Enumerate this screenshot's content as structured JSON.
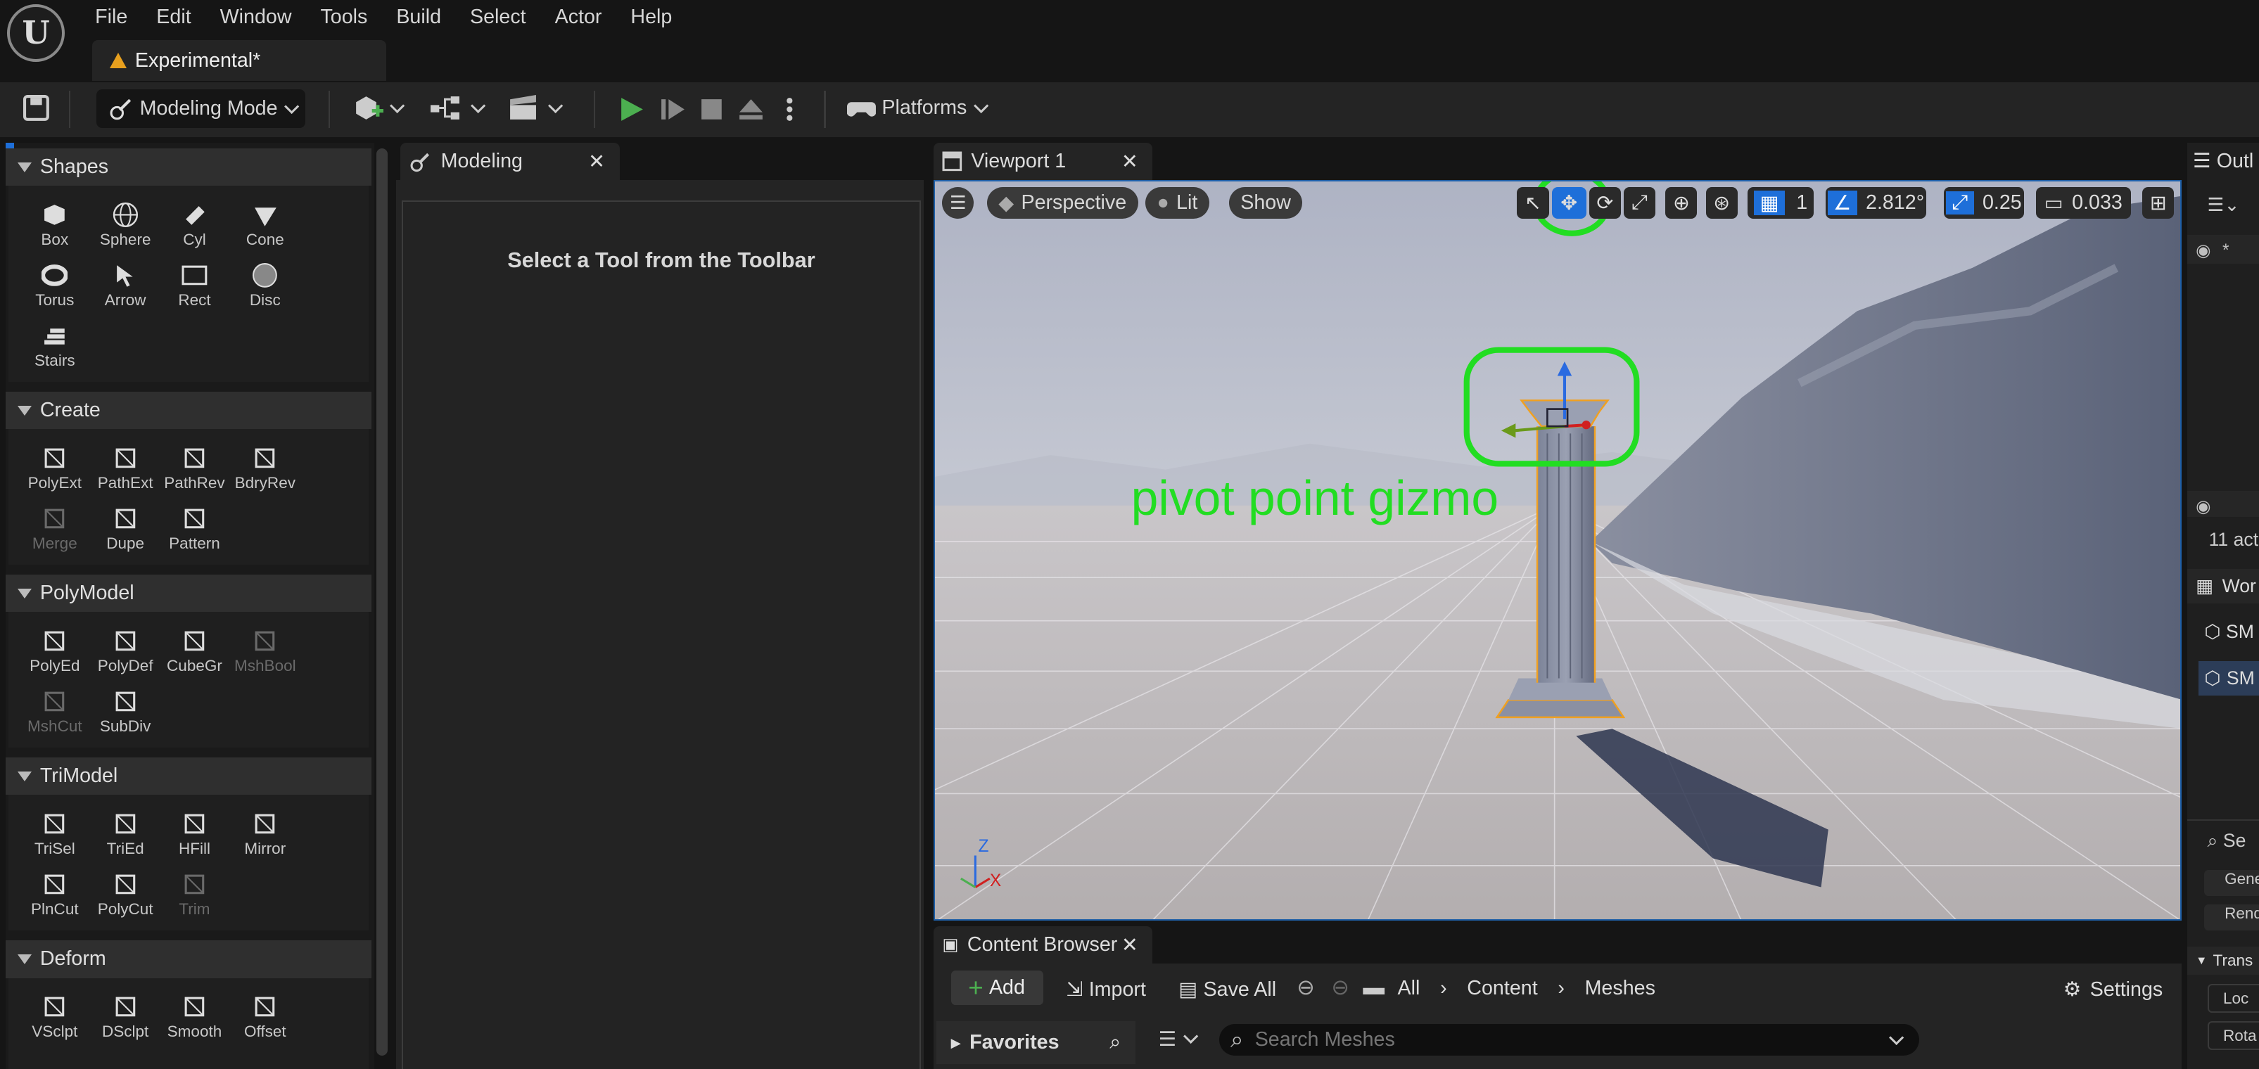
{
  "menu": [
    "File",
    "Edit",
    "Window",
    "Tools",
    "Build",
    "Select",
    "Actor",
    "Help"
  ],
  "doc_tab": "Experimental*",
  "toolbar": {
    "mode": "Modeling Mode",
    "platforms": "Platforms"
  },
  "sections": [
    {
      "title": "Shapes",
      "tools": [
        {
          "label": "Box",
          "icon": "box-icon"
        },
        {
          "label": "Sphere",
          "icon": "sphere-icon"
        },
        {
          "label": "Cyl",
          "icon": "cylinder-icon"
        },
        {
          "label": "Cone",
          "icon": "cone-icon"
        },
        {
          "label": "Torus",
          "icon": "torus-icon"
        },
        {
          "label": "Arrow",
          "icon": "arrow-icon"
        },
        {
          "label": "Rect",
          "icon": "rect-icon"
        },
        {
          "label": "Disc",
          "icon": "disc-icon"
        },
        {
          "label": "Stairs",
          "icon": "stairs-icon"
        }
      ]
    },
    {
      "title": "Create",
      "tools": [
        {
          "label": "PolyExt",
          "icon": "polyext-icon"
        },
        {
          "label": "PathExt",
          "icon": "pathext-icon"
        },
        {
          "label": "PathRev",
          "icon": "pathrev-icon"
        },
        {
          "label": "BdryRev",
          "icon": "bdryrev-icon"
        },
        {
          "label": "Merge",
          "icon": "merge-icon",
          "disabled": true
        },
        {
          "label": "Dupe",
          "icon": "dupe-icon"
        },
        {
          "label": "Pattern",
          "icon": "pattern-icon"
        }
      ]
    },
    {
      "title": "PolyModel",
      "tools": [
        {
          "label": "PolyEd",
          "icon": "polyed-icon"
        },
        {
          "label": "PolyDef",
          "icon": "polydef-icon"
        },
        {
          "label": "CubeGr",
          "icon": "cubegr-icon"
        },
        {
          "label": "MshBool",
          "icon": "mshbool-icon",
          "disabled": true
        },
        {
          "label": "MshCut",
          "icon": "mshcut-icon",
          "disabled": true
        },
        {
          "label": "SubDiv",
          "icon": "subdiv-icon"
        }
      ]
    },
    {
      "title": "TriModel",
      "tools": [
        {
          "label": "TriSel",
          "icon": "trisel-icon"
        },
        {
          "label": "TriEd",
          "icon": "tried-icon"
        },
        {
          "label": "HFill",
          "icon": "hfill-icon"
        },
        {
          "label": "Mirror",
          "icon": "mirror-icon"
        },
        {
          "label": "PlnCut",
          "icon": "plncut-icon"
        },
        {
          "label": "PolyCut",
          "icon": "polycut-icon"
        },
        {
          "label": "Trim",
          "icon": "trim-icon",
          "disabled": true
        }
      ]
    },
    {
      "title": "Deform",
      "tools": [
        {
          "label": "VSclpt",
          "icon": "vsclpt-icon"
        },
        {
          "label": "DSclpt",
          "icon": "dsclpt-icon"
        },
        {
          "label": "Smooth",
          "icon": "smooth-icon"
        },
        {
          "label": "Offset",
          "icon": "offset-icon"
        }
      ]
    }
  ],
  "modeling": {
    "tab": "Modeling",
    "message": "Select a Tool from the Toolbar"
  },
  "viewport": {
    "tab": "Viewport 1",
    "perspective": "Perspective",
    "lit": "Lit",
    "show": "Show",
    "grid": "1",
    "angle": "2.812°",
    "scale": "0.25",
    "camera": "0.033",
    "annotation": "pivot point gizmo",
    "annotation_color": "#22dd22",
    "axis_z": "Z",
    "axis_x": "X"
  },
  "content_browser": {
    "tab": "Content Browser",
    "add": "Add",
    "import": "Import",
    "save_all": "Save All",
    "breadcrumb": [
      "All",
      "Content",
      "Meshes"
    ],
    "settings": "Settings",
    "favorites": "Favorites",
    "search_placeholder": "Search Meshes"
  },
  "outliner": {
    "tab": "Outl",
    "count": "11 act",
    "world": "Wor",
    "item1": "SM",
    "item2": "SM",
    "search": "Se",
    "gen": "Gene",
    "rend": "Rend",
    "transform": "Trans",
    "loc": "Loc",
    "rot": "Rota"
  }
}
